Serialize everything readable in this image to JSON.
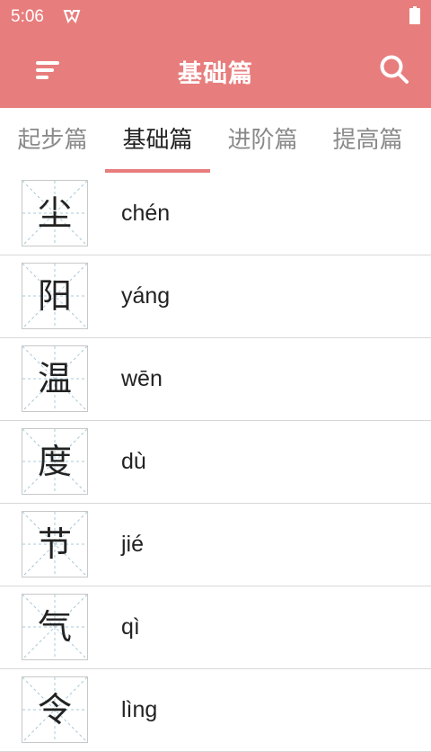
{
  "status_bar": {
    "time": "5:06"
  },
  "app_bar": {
    "title": "基础篇"
  },
  "tabs": [
    {
      "label": "起步篇",
      "active": false
    },
    {
      "label": "基础篇",
      "active": true
    },
    {
      "label": "进阶篇",
      "active": false
    },
    {
      "label": "提高篇",
      "active": false
    }
  ],
  "words": [
    {
      "char": "尘",
      "pinyin": "chén"
    },
    {
      "char": "阳",
      "pinyin": "yáng"
    },
    {
      "char": "温",
      "pinyin": "wēn"
    },
    {
      "char": "度",
      "pinyin": "dù"
    },
    {
      "char": "节",
      "pinyin": "jié"
    },
    {
      "char": "气",
      "pinyin": "qì"
    },
    {
      "char": "令",
      "pinyin": "lìng"
    }
  ],
  "colors": {
    "accent": "#e87d7d",
    "text": "#222222",
    "inactive_tab": "#8a8a8a",
    "grid_line": "#a8c8d8"
  }
}
